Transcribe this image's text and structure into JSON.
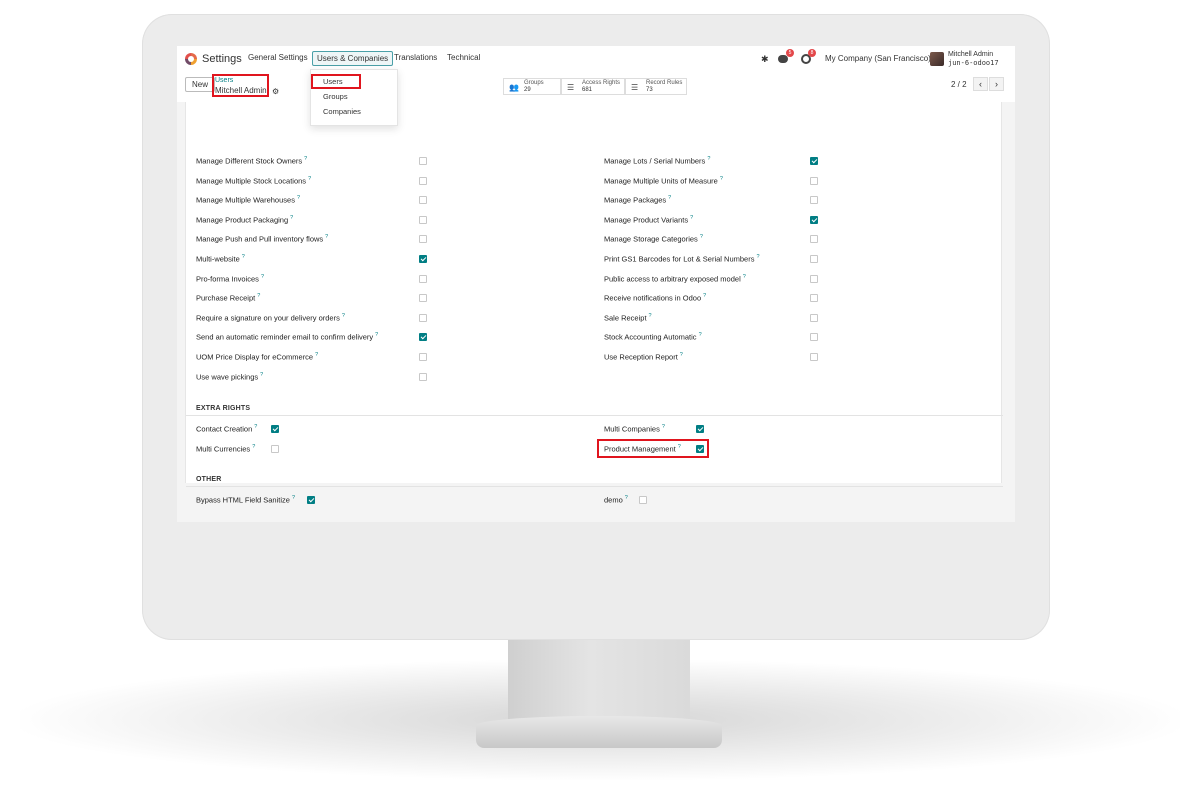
{
  "navbar": {
    "app_name": "Settings",
    "menus": [
      "General Settings",
      "Users & Companies",
      "Translations",
      "Technical"
    ],
    "active_menu_index": 1,
    "chat_count": "5",
    "activity_count": "8",
    "company": "My Company (San Francisco)",
    "user_name": "Mitchell Admin",
    "database": "jun-6-odoo17"
  },
  "control": {
    "new_label": "New",
    "breadcrumb_parent": "Users",
    "breadcrumb_current": "Mitchell Admin",
    "smart_buttons": [
      {
        "label": "Groups",
        "count": "29",
        "icon": "users-icon"
      },
      {
        "label": "Access Rights",
        "count": "681",
        "icon": "list-icon"
      },
      {
        "label": "Record Rules",
        "count": "73",
        "icon": "list-icon"
      }
    ],
    "pager": "2 / 2"
  },
  "dropdown": {
    "items": [
      "Users",
      "Groups",
      "Companies"
    ],
    "highlighted_index": 0
  },
  "technical_left": [
    {
      "label": "Manage Different Stock Owners",
      "checked": false
    },
    {
      "label": "Manage Multiple Stock Locations",
      "checked": false
    },
    {
      "label": "Manage Multiple Warehouses",
      "checked": false
    },
    {
      "label": "Manage Product Packaging",
      "checked": false
    },
    {
      "label": "Manage Push and Pull inventory flows",
      "checked": false
    },
    {
      "label": "Multi-website",
      "checked": true
    },
    {
      "label": "Pro-forma Invoices",
      "checked": false
    },
    {
      "label": "Purchase Receipt",
      "checked": false
    },
    {
      "label": "Require a signature on your delivery orders",
      "checked": false
    },
    {
      "label": "Send an automatic reminder email to confirm delivery",
      "checked": true
    },
    {
      "label": "UOM Price Display for eCommerce",
      "checked": false
    },
    {
      "label": "Use wave pickings",
      "checked": false
    }
  ],
  "technical_right": [
    {
      "label": "Manage Lots / Serial Numbers",
      "checked": true
    },
    {
      "label": "Manage Multiple Units of Measure",
      "checked": false
    },
    {
      "label": "Manage Packages",
      "checked": false
    },
    {
      "label": "Manage Product Variants",
      "checked": true
    },
    {
      "label": "Manage Storage Categories",
      "checked": false
    },
    {
      "label": "Print GS1 Barcodes for Lot & Serial Numbers",
      "checked": false
    },
    {
      "label": "Public access to arbitrary exposed model",
      "checked": false
    },
    {
      "label": "Receive notifications in Odoo",
      "checked": false
    },
    {
      "label": "Sale Receipt",
      "checked": false
    },
    {
      "label": "Stock Accounting Automatic",
      "checked": false
    },
    {
      "label": "Use Reception Report",
      "checked": false
    }
  ],
  "extra_rights": {
    "title": "EXTRA RIGHTS",
    "left": [
      {
        "label": "Contact Creation",
        "checked": true
      },
      {
        "label": "Multi Currencies",
        "checked": false
      }
    ],
    "right": [
      {
        "label": "Multi Companies",
        "checked": true
      },
      {
        "label": "Product Management",
        "checked": true
      }
    ]
  },
  "other": {
    "title": "OTHER",
    "left": [
      {
        "label": "Bypass HTML Field Sanitize",
        "checked": true
      }
    ],
    "right": [
      {
        "label": "demo",
        "checked": false
      }
    ]
  },
  "help_mark": "?",
  "colors": {
    "accent": "#017e84",
    "highlight": "#e0151e",
    "badge": "#e3474a"
  }
}
